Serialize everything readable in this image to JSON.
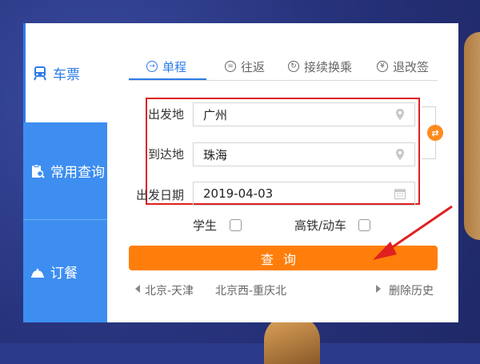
{
  "sidebar": {
    "items": [
      {
        "label": "车票",
        "icon": "train-icon"
      },
      {
        "label": "常用查询",
        "icon": "clipboard-search-icon"
      },
      {
        "label": "订餐",
        "icon": "meal-bell-icon"
      }
    ]
  },
  "tabs": [
    {
      "label": "单程",
      "icon": "arrow-right-circle-icon",
      "active": true
    },
    {
      "label": "往返",
      "icon": "round-trip-icon"
    },
    {
      "label": "接续换乘",
      "icon": "transfer-icon"
    },
    {
      "label": "退改签",
      "icon": "refund-icon"
    }
  ],
  "form": {
    "from_label": "出发地",
    "from_value": "广州",
    "to_label": "到达地",
    "to_value": "珠海",
    "date_label": "出发日期",
    "date_value": "2019-04-03",
    "swap_symbol": "⇄"
  },
  "options": {
    "student_label": "学生",
    "highspeed_label": "高铁/动车"
  },
  "search_button": "查询",
  "history": {
    "items": [
      "北京-天津",
      "北京西-重庆北"
    ],
    "clear_label": "删除历史"
  },
  "colors": {
    "primary_blue": "#3d8ef0",
    "accent_orange": "#ff7e0b",
    "annotation_red": "#e02020",
    "background_navy": "#2b3a8a"
  }
}
